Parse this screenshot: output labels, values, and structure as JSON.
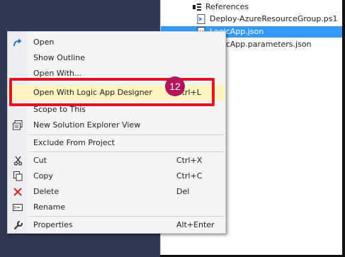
{
  "solution_explorer": {
    "items": [
      {
        "label": "References",
        "icon": "references-icon"
      },
      {
        "label": "Deploy-AzureResourceGroup.ps1",
        "icon": "powershell-file-icon"
      },
      {
        "label": "LogicApp.json",
        "icon": "json-file-icon",
        "selected": true
      },
      {
        "label": "LogicApp.parameters.json",
        "icon": "json-file-icon"
      }
    ]
  },
  "context_menu": {
    "items": [
      {
        "label": "Open",
        "shortcut": "",
        "icon": "open-arrow-icon"
      },
      {
        "label": "Show Outline",
        "shortcut": "",
        "icon": ""
      },
      {
        "label": "Open With...",
        "shortcut": "",
        "icon": ""
      },
      {
        "label": "Open With Logic App Designer",
        "shortcut": "Ctrl+L",
        "icon": "",
        "highlighted": true
      },
      {
        "label": "Scope to This",
        "shortcut": "",
        "icon": ""
      },
      {
        "label": "New Solution Explorer View",
        "shortcut": "",
        "icon": "new-view-icon"
      },
      {
        "label": "Exclude From Project",
        "shortcut": "",
        "icon": ""
      },
      {
        "label": "Cut",
        "shortcut": "Ctrl+X",
        "icon": "scissors-icon"
      },
      {
        "label": "Copy",
        "shortcut": "Ctrl+C",
        "icon": "copy-icon"
      },
      {
        "label": "Delete",
        "shortcut": "Del",
        "icon": "delete-x-icon"
      },
      {
        "label": "Rename",
        "shortcut": "",
        "icon": "rename-icon"
      },
      {
        "label": "Properties",
        "shortcut": "Alt+Enter",
        "icon": "wrench-icon"
      }
    ]
  },
  "callout": {
    "step_number": "12",
    "color": "#e6121f",
    "badge_color": "#b0175a"
  },
  "colors": {
    "selection": "#3399ff",
    "highlight": "#fdf4bf",
    "background": "#2e3a56"
  }
}
